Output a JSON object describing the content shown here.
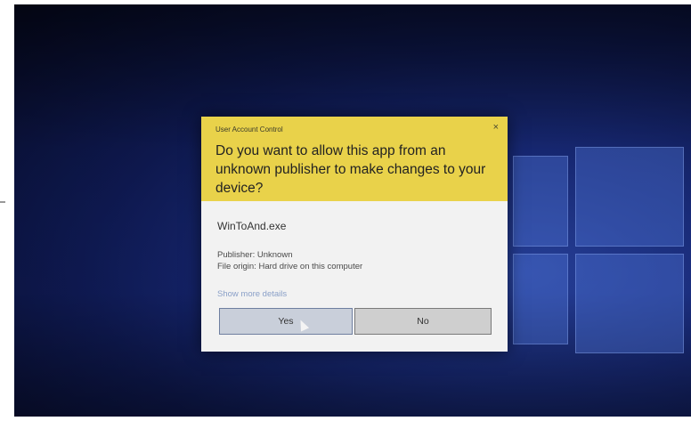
{
  "dialog": {
    "caption": "User Account Control",
    "close_glyph": "×",
    "question": "Do you want to allow this app from an unknown publisher to make changes to your device?",
    "app_name": "WinToAnd.exe",
    "publisher": "Publisher: Unknown",
    "file_origin": "File origin: Hard drive on this computer",
    "details_link": "Show more details",
    "yes_label": "Yes",
    "no_label": "No"
  },
  "colors": {
    "header": "#e9d24a",
    "dialog_body": "#f2f2f2",
    "desktop": "#1b2f86"
  },
  "icons": {
    "close": "close-icon",
    "cursor": "mouse-pointer-icon"
  }
}
